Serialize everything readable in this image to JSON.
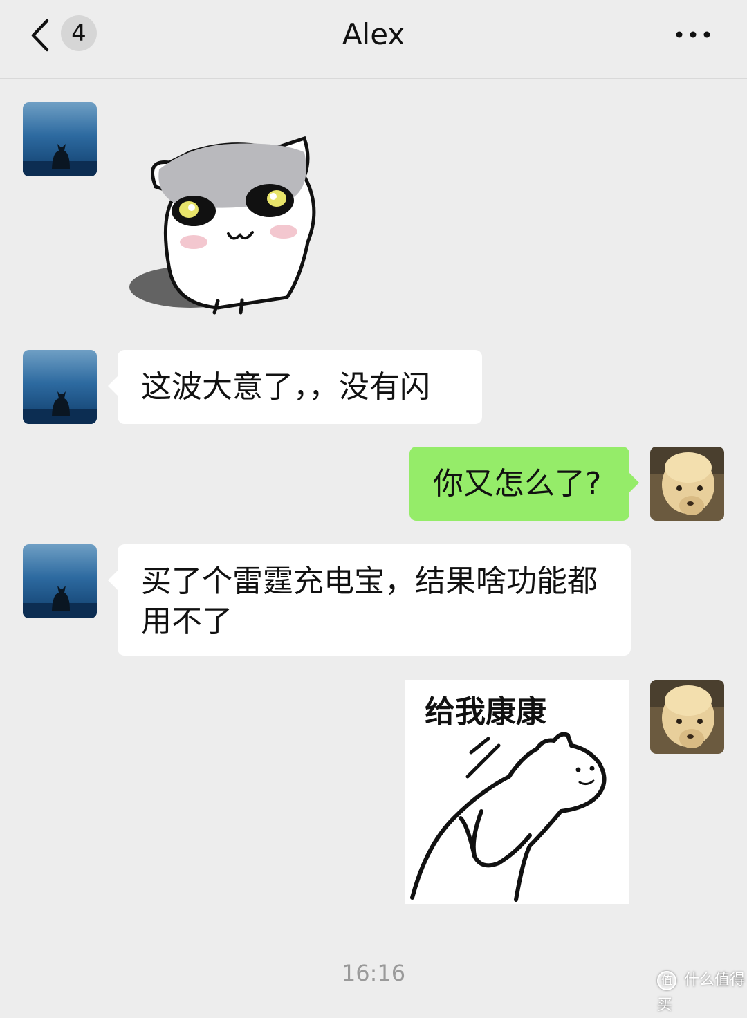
{
  "header": {
    "back_icon": "chevron-left-icon",
    "unread_count": "4",
    "title": "Alex",
    "more_icon": "more-dots-icon"
  },
  "messages": [
    {
      "side": "left",
      "type": "sticker",
      "sticker": "grumpy-cat-sticker"
    },
    {
      "side": "left",
      "type": "text",
      "text": "这波大意了，，没有闪"
    },
    {
      "side": "right",
      "type": "text",
      "text": "你又怎么了?"
    },
    {
      "side": "left",
      "type": "text",
      "line1": "买了个雷霆充电宝，结果啥功能都",
      "line2": "用不了"
    },
    {
      "side": "right",
      "type": "sticker",
      "caption": "给我康康"
    }
  ],
  "timestamp": "16:16",
  "watermark": {
    "icon_text": "值",
    "text": "什么值得买"
  },
  "colors": {
    "background": "#ededed",
    "left_bubble": "#ffffff",
    "right_bubble": "#95ec69"
  }
}
